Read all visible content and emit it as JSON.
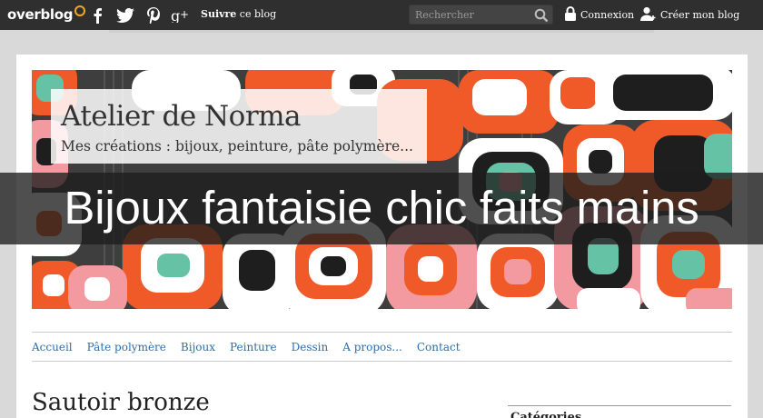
{
  "topbar": {
    "logo_text": "overblog",
    "follow_bold": "Suivre",
    "follow_rest": " ce blog",
    "search_placeholder": "Rechercher",
    "login_label": "Connexion",
    "create_label": "Créer mon blog"
  },
  "blog": {
    "title": "Atelier de Norma",
    "description": "Mes créations : bijoux, peinture, pâte polymère..."
  },
  "overlay_title": "Bijoux fantaisie chic faits mains",
  "menu": [
    {
      "label": "Accueil"
    },
    {
      "label": "Pâte polymère"
    },
    {
      "label": "Bijoux"
    },
    {
      "label": "Peinture"
    },
    {
      "label": "Dessin"
    },
    {
      "label": "A propos..."
    },
    {
      "label": "Contact"
    }
  ],
  "post": {
    "title": "Sautoir bronze"
  },
  "sidebar": {
    "title": "Catégories"
  },
  "colors": {
    "topbar": "#2f2f2f",
    "link": "#2a6fb0",
    "banner_orange": "#f05a28",
    "banner_teal": "#66c2a5",
    "banner_pink": "#f39aa0",
    "banner_dark": "#1e1e1e"
  }
}
